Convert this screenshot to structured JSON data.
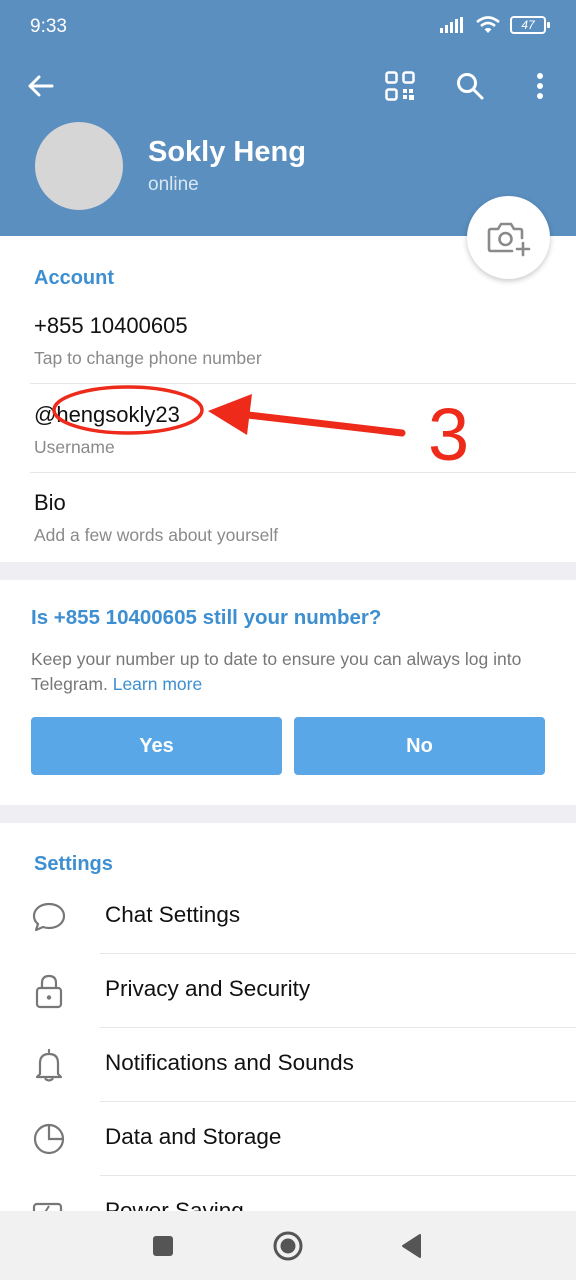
{
  "status_bar": {
    "time": "9:33",
    "battery": "47"
  },
  "header": {
    "name": "Sokly Heng",
    "status": "online"
  },
  "account": {
    "title": "Account",
    "phone": "+855 10400605",
    "phone_hint": "Tap to change phone number",
    "username": "@hengsokly23",
    "username_hint": "Username",
    "bio": "Bio",
    "bio_hint": "Add a few words about yourself"
  },
  "annotation": {
    "number": "3",
    "color": "#ee2a1b"
  },
  "number_prompt": {
    "title": "Is +855 10400605 still your number?",
    "text": "Keep your number up to date to ensure you can always log into Telegram.",
    "link": "Learn more",
    "yes": "Yes",
    "no": "No"
  },
  "settings": {
    "title": "Settings",
    "items": [
      {
        "label": "Chat Settings",
        "icon": "chat-bubble-icon"
      },
      {
        "label": "Privacy and Security",
        "icon": "lock-icon"
      },
      {
        "label": "Notifications and Sounds",
        "icon": "bell-icon"
      },
      {
        "label": "Data and Storage",
        "icon": "pie-chart-icon"
      },
      {
        "label": "Power Saving",
        "icon": "battery-saver-icon"
      }
    ]
  },
  "colors": {
    "header": "#5b8fbf",
    "accent": "#3d8fd1",
    "button": "#5aa7e8"
  }
}
